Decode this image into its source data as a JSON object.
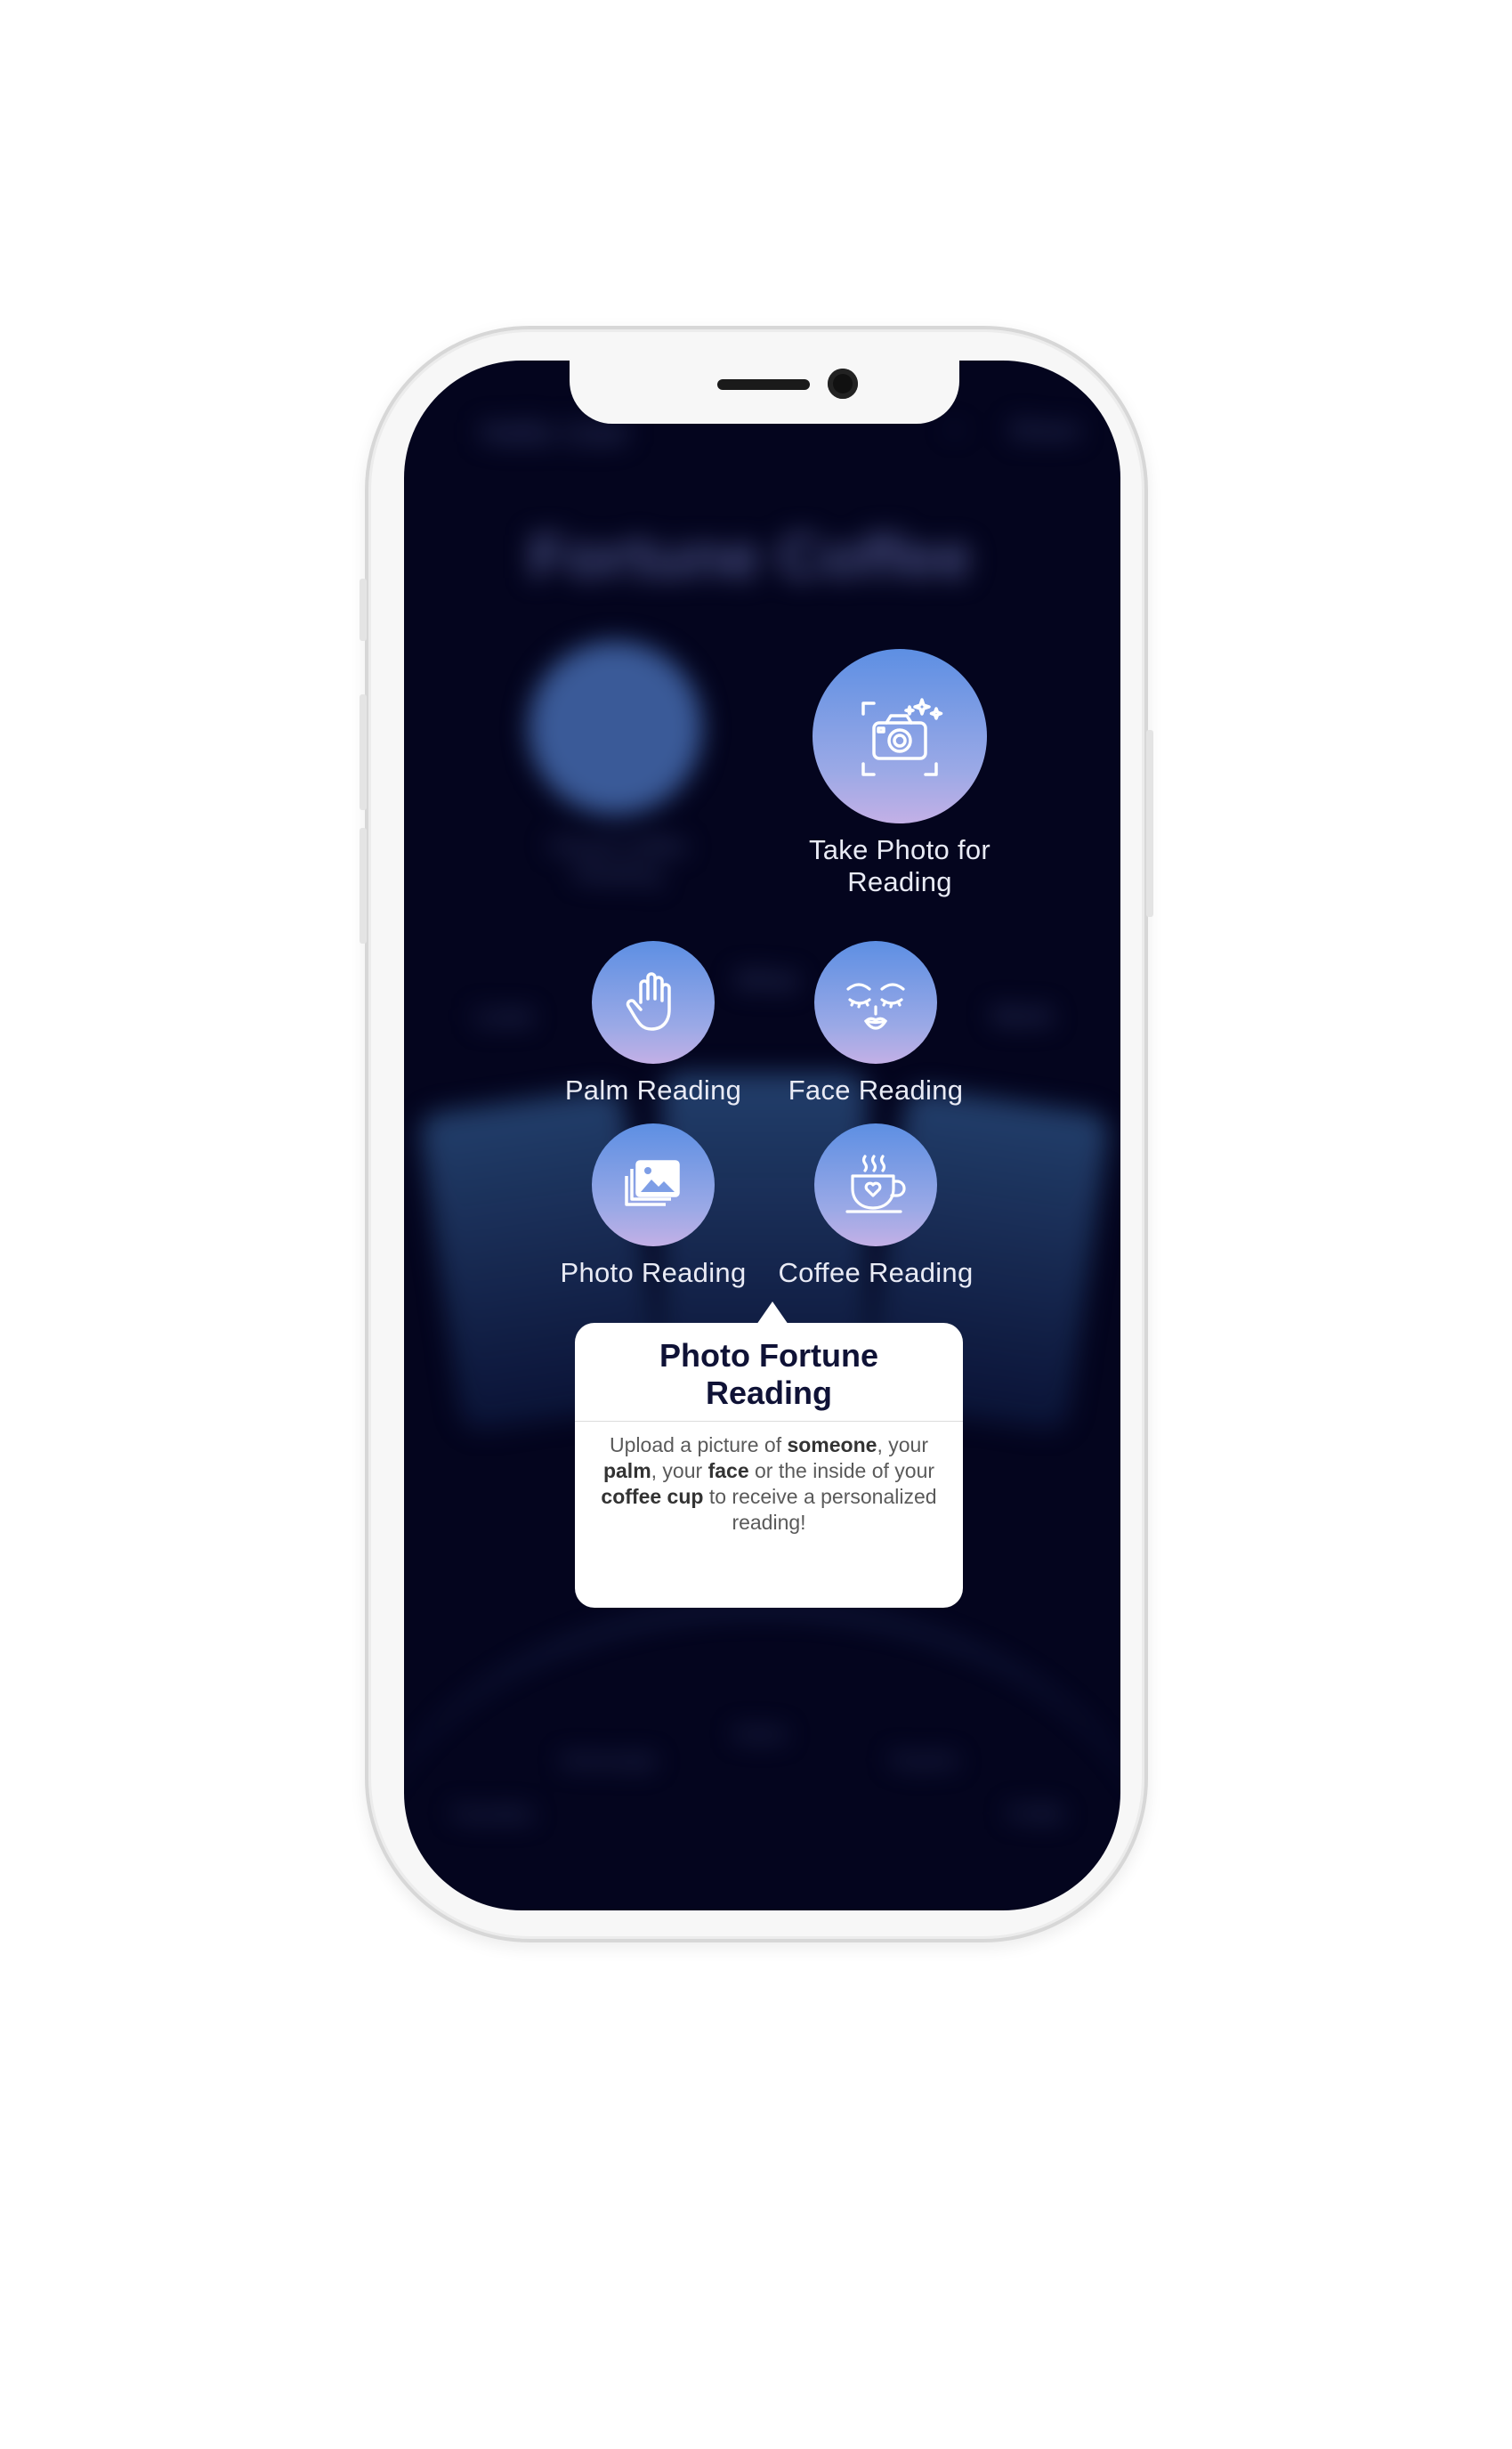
{
  "header": {
    "greeting": "Hello User",
    "share_label": "Share"
  },
  "app": {
    "title": "Fortune Coffee"
  },
  "blurred_features": {
    "virtual_coffee_label": "Virtual Coffee Reading",
    "topics": [
      "Love",
      "What",
      "Work"
    ]
  },
  "features": {
    "take_photo": {
      "label": "Take Photo for Reading",
      "icon": "camera-sparkle-icon"
    },
    "palm": {
      "label": "Palm Reading",
      "icon": "hand-icon"
    },
    "face": {
      "label": "Face Reading",
      "icon": "face-icon"
    },
    "photo": {
      "label": "Photo Reading",
      "icon": "image-icon"
    },
    "coffee": {
      "label": "Coffee Reading",
      "icon": "coffee-cup-icon"
    }
  },
  "tooltip": {
    "title": "Photo Fortune Reading",
    "body_1": "Upload a picture of ",
    "b1": "someone",
    "body_2": ", your ",
    "b2": "palm",
    "body_3": ", your ",
    "b3": "face",
    "body_4": " or the inside of your ",
    "b4": "coffee cup",
    "body_5": " to receive a personalized reading!"
  },
  "bottom_nav": {
    "items": [
      "Favorites",
      "Horoscope",
      "Home",
      "Psychic",
      "Profile"
    ]
  },
  "colors": {
    "screen_bg": "#04051e",
    "button_gradient_top": "#5d8fe3",
    "button_gradient_bottom": "#c3b0e6",
    "tooltip_title": "#0f1236"
  }
}
